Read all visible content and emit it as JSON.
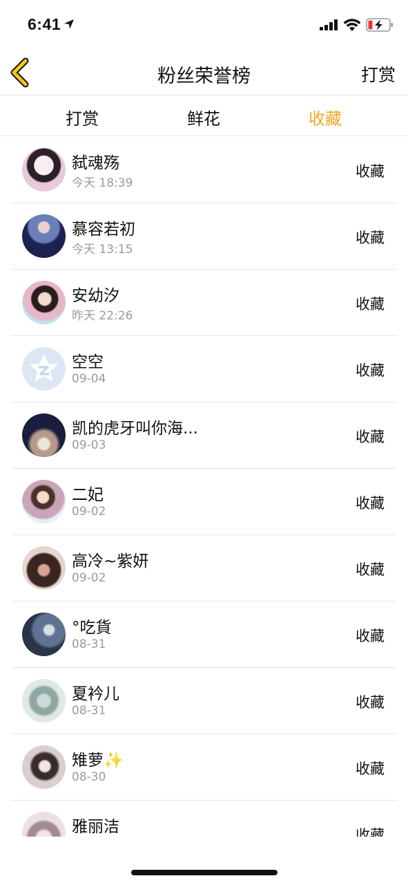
{
  "status_bar": {
    "time": "6:41"
  },
  "nav": {
    "title": "粉丝荣誉榜",
    "right_label": "打赏"
  },
  "tabs": [
    {
      "label": "打赏"
    },
    {
      "label": "鲜花"
    },
    {
      "label": "收藏",
      "active": true
    }
  ],
  "colors": {
    "accent": "#f3a623",
    "text": "#111111",
    "subtext": "#9a9a9a",
    "divider": "#e6e6e6"
  },
  "list": [
    {
      "name": "弑魂殇",
      "time": "今天 18:39",
      "action": "收藏"
    },
    {
      "name": "慕容若初",
      "time": "今天 13:15",
      "action": "收藏"
    },
    {
      "name": "安幼汐",
      "time": "昨天 22:26",
      "action": "收藏"
    },
    {
      "name": "空空",
      "time": "09-04",
      "action": "收藏"
    },
    {
      "name": "凯的虎牙叫你海...",
      "time": "09-03",
      "action": "收藏"
    },
    {
      "name": "二妃",
      "time": "09-02",
      "action": "收藏"
    },
    {
      "name": "高冷~紫妍",
      "time": "09-02",
      "action": "收藏"
    },
    {
      "name": "°吃貨",
      "time": "08-31",
      "action": "收藏"
    },
    {
      "name": "夏衿儿",
      "time": "08-31",
      "action": "收藏"
    },
    {
      "name": "雉萝✨",
      "time": "08-30",
      "action": "收藏"
    },
    {
      "name": "雅丽洁",
      "time": "",
      "action": "收藏"
    }
  ]
}
